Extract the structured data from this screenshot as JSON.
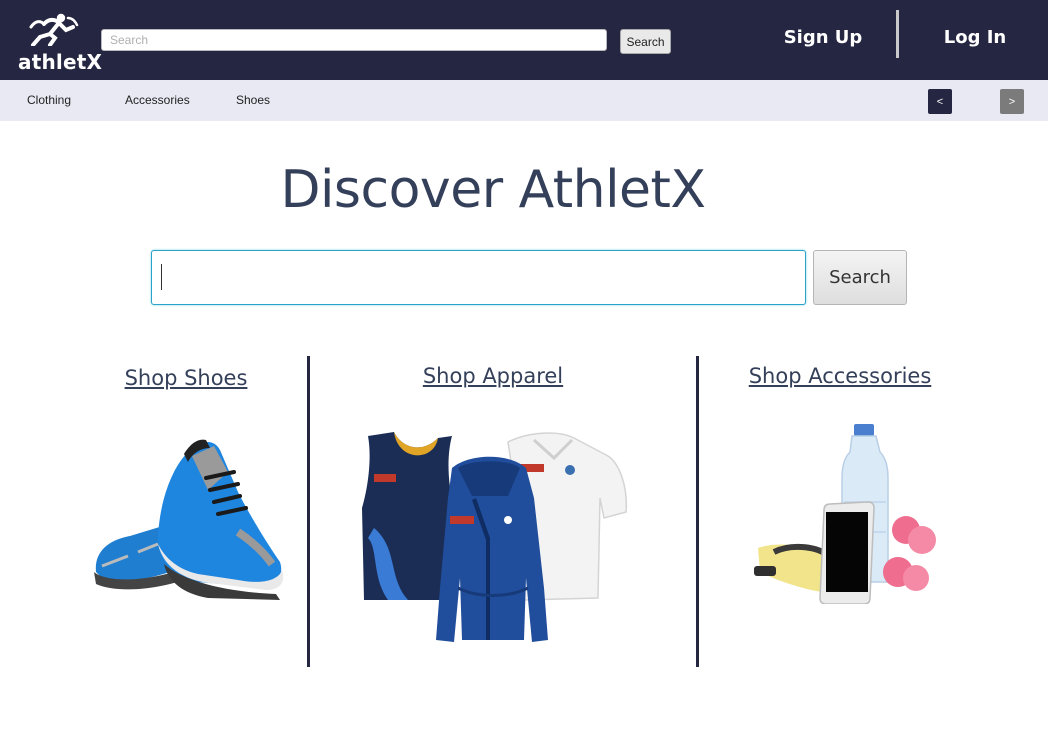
{
  "header": {
    "logo_text": "athletX",
    "search_placeholder": "Search",
    "search_button": "Search",
    "signup_label": "Sign Up",
    "login_label": "Log In",
    "background_color": "#252641"
  },
  "categories": {
    "items": [
      {
        "label": "Clothing"
      },
      {
        "label": "Accessories"
      },
      {
        "label": "Shoes"
      }
    ],
    "prev_label": "<",
    "next_label": ">"
  },
  "hero": {
    "title": "Discover AthletX",
    "search_value": "",
    "search_button": "Search"
  },
  "shops": [
    {
      "label": "Shop Shoes",
      "image": "blue-running-shoes"
    },
    {
      "label": "Shop Apparel",
      "image": "team-apparel-jersey-hoodie-polo"
    },
    {
      "label": "Shop Accessories",
      "image": "water-bottle-phone-dumbbells"
    }
  ]
}
